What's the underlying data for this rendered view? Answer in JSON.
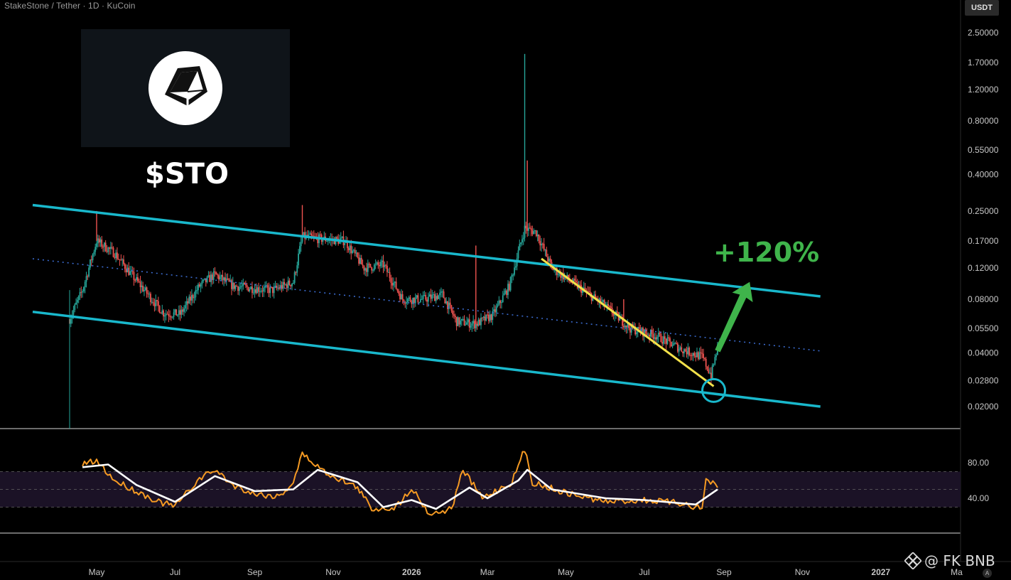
{
  "header": {
    "symbol_line": "StakeStone / Tether · 1D · KuCoin",
    "currency_badge": "USDT"
  },
  "overlay": {
    "ticker": "$STO",
    "target_pct": "+120%",
    "watermark": "@ FK BNB",
    "logo_icon": "stakestone-gem-icon",
    "auto_button": "A"
  },
  "colors": {
    "background": "#000000",
    "channel": "#19b8cc",
    "midline": "#3d6fd6",
    "trendline": "#f2e14a",
    "target": "#3fb44b",
    "candle_up": "#26a69a",
    "candle_down": "#ef5350",
    "rsi": "#f59a23",
    "rsi_ma": "#ffffff"
  },
  "chart_data": [
    {
      "type": "candlestick",
      "scale": "log",
      "price_axis_ticks": [
        2.5,
        1.7,
        1.2,
        0.8,
        0.55,
        0.4,
        0.25,
        0.17,
        0.12,
        0.08,
        0.055,
        0.04,
        0.028,
        0.02
      ],
      "price_axis_labels": [
        "2.50000",
        "1.70000",
        "1.20000",
        "0.80000",
        "0.55000",
        "0.40000",
        "0.25000",
        "0.17000",
        "0.12000",
        "0.08000",
        "0.05500",
        "0.04000",
        "0.02800",
        "0.02000"
      ],
      "time_axis_labels": [
        "May",
        "Jul",
        "Sep",
        "Nov",
        "2026",
        "Mar",
        "May",
        "Jul",
        "Sep",
        "Nov",
        "2027",
        "Ma"
      ],
      "time_axis_dates": [
        "2025-05-01",
        "2025-07-01",
        "2025-09-01",
        "2025-11-01",
        "2026-01-01",
        "2026-03-01",
        "2026-05-01",
        "2026-07-01",
        "2026-09-01",
        "2026-11-01",
        "2027-01-01",
        "2027-03-01"
      ],
      "close_path": [
        [
          "2025-04-10",
          0.062
        ],
        [
          "2025-04-20",
          0.09
        ],
        [
          "2025-05-01",
          0.17
        ],
        [
          "2025-05-15",
          0.145
        ],
        [
          "2025-05-28",
          0.11
        ],
        [
          "2025-06-10",
          0.085
        ],
        [
          "2025-06-22",
          0.067
        ],
        [
          "2025-07-05",
          0.066
        ],
        [
          "2025-07-20",
          0.095
        ],
        [
          "2025-08-01",
          0.11
        ],
        [
          "2025-08-15",
          0.095
        ],
        [
          "2025-09-01",
          0.092
        ],
        [
          "2025-09-15",
          0.09
        ],
        [
          "2025-10-01",
          0.1
        ],
        [
          "2025-10-08",
          0.18
        ],
        [
          "2025-10-20",
          0.175
        ],
        [
          "2025-11-10",
          0.17
        ],
        [
          "2025-11-25",
          0.12
        ],
        [
          "2025-12-10",
          0.125
        ],
        [
          "2025-12-25",
          0.08
        ],
        [
          "2026-01-10",
          0.08
        ],
        [
          "2026-01-25",
          0.085
        ],
        [
          "2026-02-05",
          0.06
        ],
        [
          "2026-02-20",
          0.058
        ],
        [
          "2026-03-05",
          0.065
        ],
        [
          "2026-03-18",
          0.095
        ],
        [
          "2026-03-30",
          0.2
        ],
        [
          "2026-04-08",
          0.19
        ],
        [
          "2026-04-20",
          0.12
        ],
        [
          "2026-05-10",
          0.095
        ],
        [
          "2026-05-30",
          0.075
        ],
        [
          "2026-06-20",
          0.055
        ],
        [
          "2026-07-10",
          0.05
        ],
        [
          "2026-07-30",
          0.042
        ],
        [
          "2026-08-15",
          0.038
        ],
        [
          "2026-08-22",
          0.03
        ],
        [
          "2026-08-27",
          0.043
        ]
      ],
      "wick_highs": [
        [
          "2025-05-01",
          0.25
        ],
        [
          "2025-10-08",
          0.27
        ],
        [
          "2026-03-30",
          1.9
        ],
        [
          "2026-04-01",
          0.48
        ],
        [
          "2026-02-20",
          0.16
        ],
        [
          "2026-06-15",
          0.08
        ]
      ],
      "channel_upper": [
        [
          "2025-04-10",
          0.27
        ],
        [
          "2026-11-15",
          0.083
        ]
      ],
      "channel_lower": [
        [
          "2025-04-10",
          0.068
        ],
        [
          "2026-11-15",
          0.02
        ]
      ],
      "channel_mid": [
        [
          "2025-04-10",
          0.135
        ],
        [
          "2026-11-15",
          0.041
        ]
      ],
      "trendline": [
        [
          "2026-04-12",
          0.135
        ],
        [
          "2026-08-24",
          0.026
        ]
      ],
      "target_arrow": [
        [
          "2026-08-27",
          0.041
        ],
        [
          "2026-09-21",
          0.1
        ]
      ],
      "annotations": [
        "+120%"
      ]
    },
    {
      "type": "line",
      "name": "",
      "y_axis_ticks": [
        80,
        40
      ],
      "y_axis_labels": [
        "80.00",
        "40.00"
      ],
      "band": [
        30,
        70
      ],
      "midline": 50,
      "series": [
        {
          "values": [
            [
              "2025-04-20",
              78
            ],
            [
              "2025-05-01",
              82
            ],
            [
              "2025-05-15",
              60
            ],
            [
              "2025-06-01",
              48
            ],
            [
              "2025-06-20",
              35
            ],
            [
              "2025-07-01",
              31
            ],
            [
              "2025-07-20",
              62
            ],
            [
              "2025-08-01",
              72
            ],
            [
              "2025-08-15",
              55
            ],
            [
              "2025-09-01",
              45
            ],
            [
              "2025-09-20",
              42
            ],
            [
              "2025-10-01",
              58
            ],
            [
              "2025-10-08",
              90
            ],
            [
              "2025-10-25",
              70
            ],
            [
              "2025-11-20",
              52
            ],
            [
              "2025-12-01",
              28
            ],
            [
              "2025-12-20",
              30
            ],
            [
              "2026-01-01",
              52
            ],
            [
              "2026-01-15",
              22
            ],
            [
              "2026-02-01",
              28
            ],
            [
              "2026-02-10",
              72
            ],
            [
              "2026-02-25",
              40
            ],
            [
              "2026-03-20",
              58
            ],
            [
              "2026-03-30",
              95
            ],
            [
              "2026-04-05",
              58
            ],
            [
              "2026-05-01",
              46
            ],
            [
              "2026-06-01",
              36
            ],
            [
              "2026-07-01",
              38
            ],
            [
              "2026-08-01",
              34
            ],
            [
              "2026-08-15",
              28
            ],
            [
              "2026-08-18",
              62
            ],
            [
              "2026-08-27",
              52
            ]
          ]
        },
        {
          "values": [
            [
              "2025-04-20",
              75
            ],
            [
              "2025-05-10",
              78
            ],
            [
              "2025-06-01",
              55
            ],
            [
              "2025-07-01",
              36
            ],
            [
              "2025-08-01",
              65
            ],
            [
              "2025-09-01",
              48
            ],
            [
              "2025-10-01",
              50
            ],
            [
              "2025-10-20",
              72
            ],
            [
              "2025-11-20",
              58
            ],
            [
              "2025-12-10",
              30
            ],
            [
              "2026-01-01",
              38
            ],
            [
              "2026-01-20",
              28
            ],
            [
              "2026-02-15",
              52
            ],
            [
              "2026-03-01",
              40
            ],
            [
              "2026-03-25",
              60
            ],
            [
              "2026-04-01",
              72
            ],
            [
              "2026-04-20",
              50
            ],
            [
              "2026-06-01",
              40
            ],
            [
              "2026-07-01",
              38
            ],
            [
              "2026-08-10",
              33
            ],
            [
              "2026-08-27",
              50
            ]
          ]
        }
      ]
    }
  ]
}
